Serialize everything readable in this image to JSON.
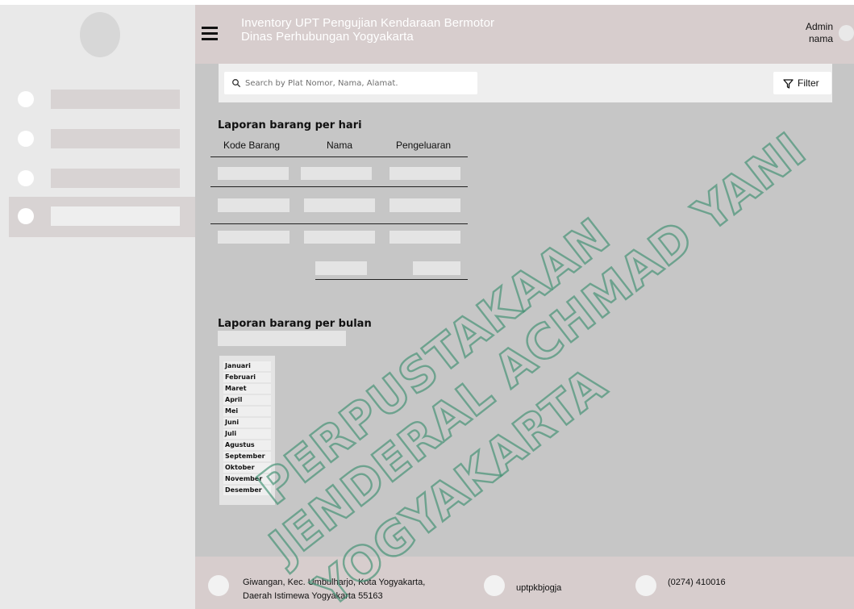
{
  "header": {
    "title_line_1": "Inventory UPT Pengujian Kendaraan Bermotor",
    "title_line_2": "Dinas Perhubungan Yogyakarta",
    "user_role": "Admin",
    "user_name": "nama"
  },
  "search": {
    "placeholder": "Search by Plat Nomor, Nama, Alamat.",
    "filter_label": "Filter"
  },
  "daily_report": {
    "title": "Laporan barang per hari",
    "columns": [
      "Kode Barang",
      "Nama",
      "Pengeluaran"
    ]
  },
  "monthly_report": {
    "title": "Laporan barang per bulan",
    "months": [
      "Januari",
      "Februari",
      "Maret",
      "April",
      "Mei",
      "Juni",
      "Juli",
      "Agustus",
      "September",
      "Oktober",
      "November",
      "Desember"
    ]
  },
  "footer": {
    "address_line_1": "Giwangan, Kec. Umbulharjo, Kota Yogyakarta,",
    "address_line_2": "Daerah Istimewa Yogyakarta 55163",
    "social": "uptpkbjogja",
    "phone": "(0274) 410016"
  },
  "watermark": {
    "line_1": "PERPUSTAKAAN",
    "line_2": "JENDERAL ACHMAD YANI",
    "line_3": "YOGYAKARTA"
  },
  "icons": {
    "menu": "hamburger-menu-icon",
    "search": "search-icon",
    "filter": "filter-icon",
    "address": "location-icon",
    "social": "social-icon",
    "phone": "phone-icon"
  },
  "colors": {
    "page": "#c6c6c6",
    "sidebar": "#e9e9e9",
    "header": "#d7cdcd",
    "footer": "#d7cdcd",
    "placeholder_block": "#e4e4e4",
    "watermark": "#3d8f70"
  }
}
